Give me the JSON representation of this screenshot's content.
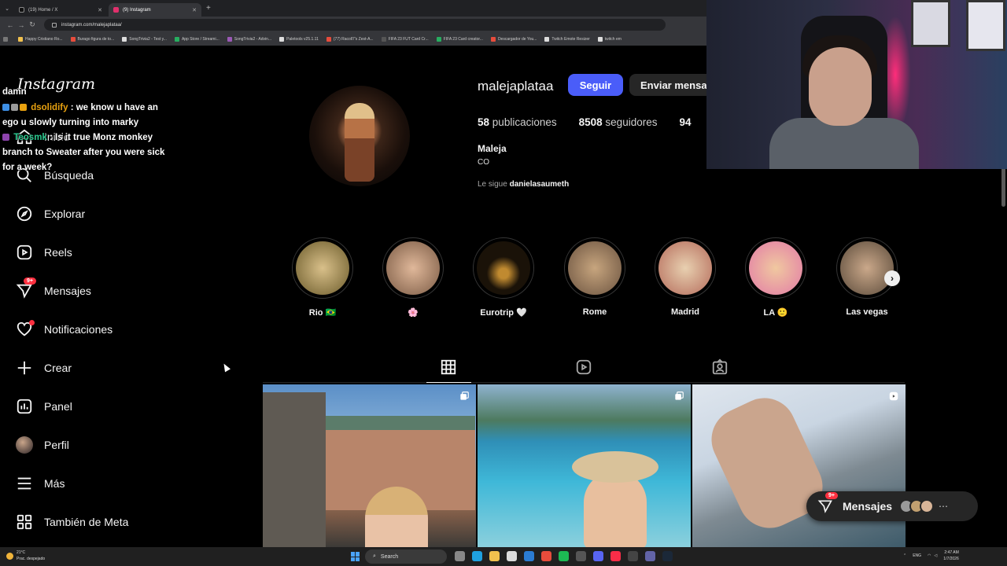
{
  "browser": {
    "tabs": [
      {
        "label": "(19) Home / X",
        "color": "#000000"
      },
      {
        "label": "(9) Instagram",
        "color": "#e1306c"
      }
    ],
    "url": "instagram.com/malejaplataa/",
    "bookmarks": [
      {
        "label": "Happy Cristiano Ro...",
        "color": "#f2c14e"
      },
      {
        "label": "Burago figura de to...",
        "color": "#e74c3c"
      },
      {
        "label": "SongTrivia2 - Test y...",
        "color": "#dddddd"
      },
      {
        "label": "App Store / Streami...",
        "color": "#27ae60"
      },
      {
        "label": "SongTrivia2 - Advin...",
        "color": "#9b59b6"
      },
      {
        "label": "Paletools v25.1.11",
        "color": "#dddddd"
      },
      {
        "label": "(77) Racoll7's Zest-A...",
        "color": "#e74c3c"
      },
      {
        "label": "FIFA 23 FUT Card Cr...",
        "color": "#555555"
      },
      {
        "label": "FIFA 23 Card creator...",
        "color": "#27ae60"
      },
      {
        "label": "Descargador de You...",
        "color": "#e74c3c"
      },
      {
        "label": "Twitch Emote Resizer",
        "color": "#dddddd"
      },
      {
        "label": "twitch em",
        "color": "#dddddd"
      }
    ]
  },
  "chat": {
    "top_line": "damn",
    "messages": [
      {
        "user": "dsolidify",
        "text": ": we know u have an ego u slowly turning into marky",
        "color": "#e8a10f"
      },
      {
        "user": "Teosmk",
        "text": ": Is it true Monz monkey branch to Sweater after you were sick for a week?",
        "color": "#2cc98f"
      }
    ]
  },
  "sidebar": {
    "logo": "Instagram",
    "items": [
      {
        "label": "Inicio",
        "icon": "home-icon"
      },
      {
        "label": "Búsqueda",
        "icon": "search-icon"
      },
      {
        "label": "Explorar",
        "icon": "compass-icon"
      },
      {
        "label": "Reels",
        "icon": "reels-icon"
      },
      {
        "label": "Mensajes",
        "icon": "messenger-icon",
        "badge": "9+"
      },
      {
        "label": "Notificaciones",
        "icon": "heart-icon"
      },
      {
        "label": "Crear",
        "icon": "plus-icon"
      },
      {
        "label": "Panel",
        "icon": "dashboard-icon"
      },
      {
        "label": "Perfil",
        "icon": "avatar-icon"
      },
      {
        "label": "Más",
        "icon": "menu-icon"
      },
      {
        "label": "También de Meta",
        "icon": "meta-grid-icon"
      }
    ]
  },
  "profile": {
    "username": "malejaplataa",
    "follow_label": "Seguir",
    "message_label": "Enviar mensaje",
    "posts_count": "58",
    "posts_label": "publicaciones",
    "followers_count": "8508",
    "followers_label": "seguidores",
    "following_count": "94",
    "name": "Maleja",
    "bio": "CO",
    "followed_by_prefix": "Le sigue",
    "followed_by_user": "danielasaumeth"
  },
  "highlights": [
    {
      "label": "Rio 🇧🇷",
      "color": "#c9a26a"
    },
    {
      "label": "🌸",
      "color": "#b98b70"
    },
    {
      "label": "Eurotrip 🤍",
      "color": "#1a1208"
    },
    {
      "label": "Rome",
      "color": "#a68565"
    },
    {
      "label": "Madrid",
      "color": "#b46a5a"
    },
    {
      "label": "LA 🙂",
      "color": "#e27aa6"
    },
    {
      "label": "Las vegas",
      "color": "#8b6e5a"
    }
  ],
  "tabs": [
    "posts-grid",
    "reels",
    "tagged"
  ],
  "messages_pill": {
    "label": "Mensajes",
    "badge": "9+"
  },
  "taskbar": {
    "temperature": "21°C",
    "weather": "Prac. despejado",
    "search": "Search",
    "lang": "ENG",
    "time": "2:47 AM",
    "date": "1/7/2026"
  }
}
